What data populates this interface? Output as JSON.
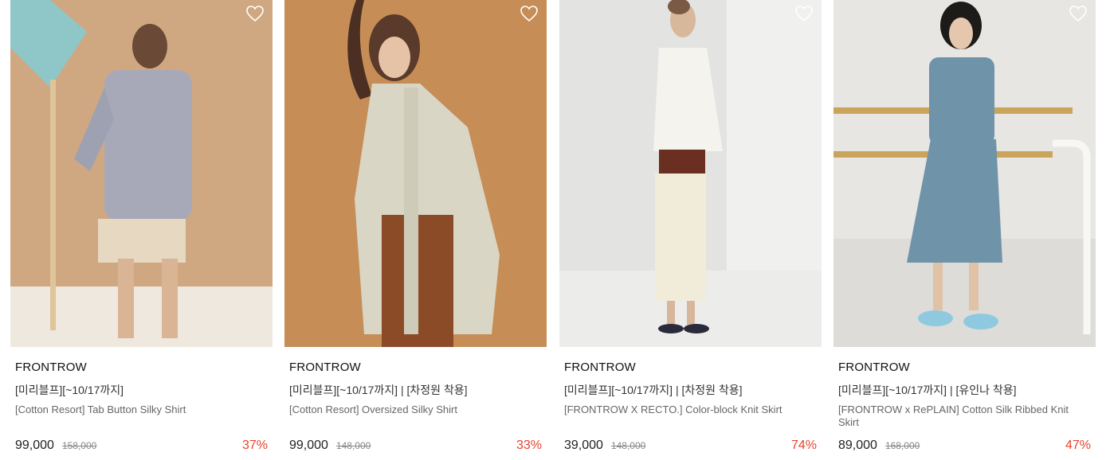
{
  "products": [
    {
      "brand": "FRONTROW",
      "tag": "[미리블프][~10/17까지]",
      "name": "[Cotton Resort] Tab Button Silky Shirt",
      "price": "99,000",
      "original_price": "158,000",
      "discount": "37%",
      "wishlist_icon": "heart-outline-icon"
    },
    {
      "brand": "FRONTROW",
      "tag": "[미리블프][~10/17까지] | [차정원 착용]",
      "name": "[Cotton Resort] Oversized Silky Shirt",
      "price": "99,000",
      "original_price": "148,000",
      "discount": "33%",
      "wishlist_icon": "heart-outline-icon"
    },
    {
      "brand": "FRONTROW",
      "tag": "[미리블프][~10/17까지] | [차정원 착용]",
      "name": "[FRONTROW X RECTO.] Color-block Knit Skirt",
      "price": "39,000",
      "original_price": "148,000",
      "discount": "74%",
      "wishlist_icon": "heart-outline-icon"
    },
    {
      "brand": "FRONTROW",
      "tag": "[미리블프][~10/17까지] | [유인나 착용]",
      "name": "[FRONTROW x RePLAIN] Cotton Silk Ribbed Knit Skirt",
      "price": "89,000",
      "original_price": "168,000",
      "discount": "47%",
      "wishlist_icon": "heart-outline-icon"
    }
  ],
  "colors": {
    "discount": "#e8432d",
    "brand": "#111111",
    "name": "#666666"
  }
}
